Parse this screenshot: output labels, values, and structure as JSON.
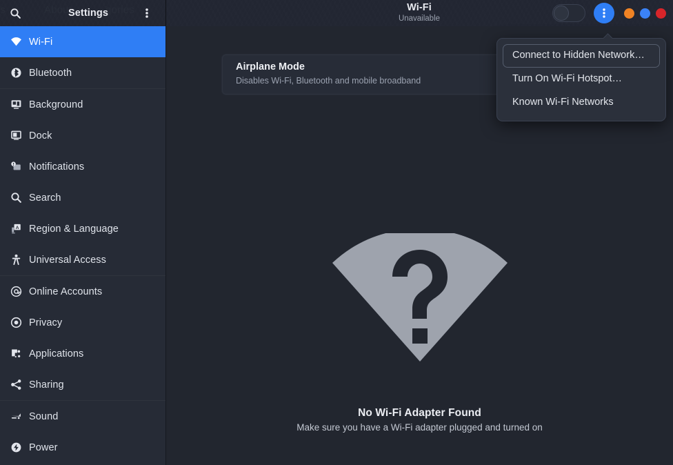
{
  "window": {
    "backdrop_text": [
      "es",
      "About",
      "gories"
    ]
  },
  "sidebar_header": {
    "title": "Settings",
    "search_icon": "search-icon",
    "menu_icon": "overflow-menu-icon"
  },
  "content_header": {
    "title": "Wi-Fi",
    "subtitle": "Unavailable",
    "toggle_state": "off",
    "menu_icon": "overflow-menu-icon",
    "window_controls": [
      {
        "name": "minimize",
        "color": "#f08324"
      },
      {
        "name": "maximize",
        "color": "#3b82f6"
      },
      {
        "name": "close",
        "color": "#d7252a"
      }
    ],
    "accent_color": "#2f7ef5"
  },
  "sidebar": {
    "selected": "Wi-Fi",
    "items": [
      {
        "label": "Wi-Fi",
        "icon": "wifi-icon",
        "selected": true
      },
      {
        "label": "Bluetooth",
        "icon": "bluetooth-icon",
        "selected": false,
        "separator_after": true
      },
      {
        "label": "Background",
        "icon": "background-icon",
        "selected": false
      },
      {
        "label": "Dock",
        "icon": "dock-icon",
        "selected": false
      },
      {
        "label": "Notifications",
        "icon": "notifications-icon",
        "selected": false
      },
      {
        "label": "Search",
        "icon": "search-icon",
        "selected": false
      },
      {
        "label": "Region & Language",
        "icon": "region-language-icon",
        "selected": false
      },
      {
        "label": "Universal Access",
        "icon": "universal-access-icon",
        "selected": false,
        "separator_after": true
      },
      {
        "label": "Online Accounts",
        "icon": "online-accounts-icon",
        "selected": false
      },
      {
        "label": "Privacy",
        "icon": "privacy-icon",
        "selected": false
      },
      {
        "label": "Applications",
        "icon": "applications-icon",
        "selected": false
      },
      {
        "label": "Sharing",
        "icon": "sharing-icon",
        "selected": false,
        "separator_after": true
      },
      {
        "label": "Sound",
        "icon": "sound-icon",
        "selected": false
      },
      {
        "label": "Power",
        "icon": "power-icon",
        "selected": false
      }
    ]
  },
  "main": {
    "airplane_card": {
      "title": "Airplane Mode",
      "subtitle": "Disables Wi-Fi, Bluetooth and mobile broadband"
    },
    "empty_state": {
      "icon": "wifi-unknown-icon",
      "title": "No Wi-Fi Adapter Found",
      "subtitle": "Make sure you have a Wi-Fi adapter plugged and turned on",
      "icon_color": "#9ea3ad"
    }
  },
  "popup_menu": {
    "open": true,
    "items": [
      {
        "label": "Connect to Hidden Network…",
        "focused": true
      },
      {
        "label": "Turn On Wi-Fi Hotspot…",
        "focused": false
      },
      {
        "label": "Known Wi-Fi Networks",
        "focused": false
      }
    ]
  }
}
